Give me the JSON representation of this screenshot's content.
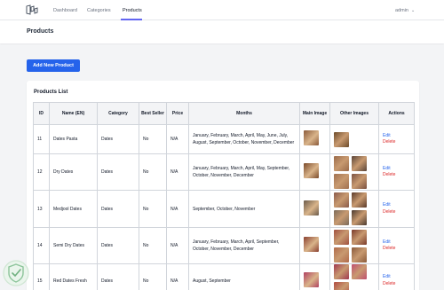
{
  "nav": {
    "links": [
      {
        "label": "Dashboard",
        "active": false
      },
      {
        "label": "Categories",
        "active": false
      },
      {
        "label": "Products",
        "active": true
      }
    ],
    "user": "admin"
  },
  "header": {
    "title": "Products"
  },
  "actions": {
    "add_label": "Add New Product"
  },
  "list": {
    "title": "Products List",
    "columns": [
      "ID",
      "Name (EN)",
      "Category",
      "Best Seller",
      "Price",
      "Months",
      "Main Image",
      "Other Images",
      "Actions"
    ],
    "edit_label": "Edit",
    "delete_label": "Delete",
    "rows": [
      {
        "id": "11",
        "name": "Dates Pasta",
        "category": "Dates",
        "best_seller": "No",
        "price": "N/A",
        "months": "January, February, March, April, May, June, July, August, September, October, November, December",
        "main_image": "#8a5a3a",
        "other_images": [
          "#6b4a2a"
        ]
      },
      {
        "id": "12",
        "name": "Dry Dates",
        "category": "Dates",
        "best_seller": "No",
        "price": "N/A",
        "months": "January, February, March, April, May, September, October, November, December",
        "main_image": "#7a4a2a",
        "other_images": [
          "#9a6a4a",
          "#5a4438",
          "#a07050",
          "#7a5040"
        ]
      },
      {
        "id": "13",
        "name": "Medjool Dates",
        "category": "Dates",
        "best_seller": "No",
        "price": "N/A",
        "months": "September, October, November",
        "main_image": "#6a5a4a",
        "other_images": [
          "#8a5a4a",
          "#5a3a2a",
          "#7a6a5a",
          "#4a3a30"
        ]
      },
      {
        "id": "14",
        "name": "Semi Dry Dates",
        "category": "Dates",
        "best_seller": "No",
        "price": "N/A",
        "months": "January, February, March, April, September, October, November, December",
        "main_image": "#8a4030",
        "other_images": [
          "#a05040",
          "#7a3a2a",
          "#b06a4a",
          "#8a5a3a"
        ]
      },
      {
        "id": "15",
        "name": "Red Dates Fresh",
        "category": "Dates",
        "best_seller": "No",
        "price": "N/A",
        "months": "August, September",
        "main_image": "#b04060",
        "other_images": [
          "#a03850",
          "#c05070",
          "#b04a40"
        ]
      }
    ]
  },
  "colors": {
    "primary": "#2563eb",
    "delete": "#dc2626",
    "nav_active": "#6366f1"
  }
}
